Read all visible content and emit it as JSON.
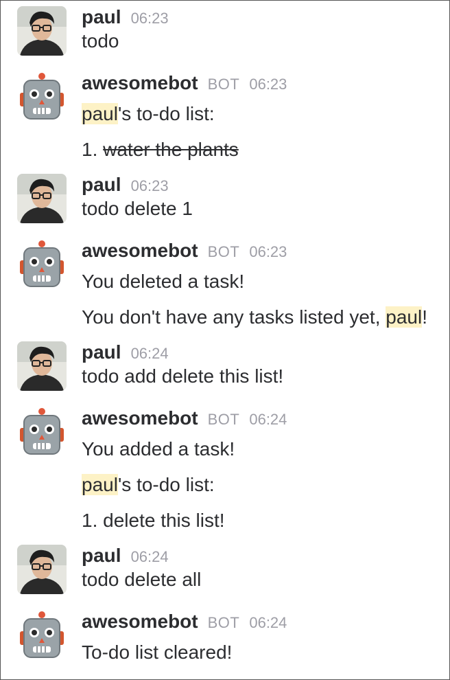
{
  "messages": [
    {
      "author": "paul",
      "time": "06:23",
      "lines": [
        {
          "text": "todo"
        }
      ]
    },
    {
      "author": "awesomebot",
      "badge": "BOT",
      "time": "06:23",
      "lines": [
        {
          "mention": "paul",
          "after": "'s to-do list:"
        },
        {
          "prefix": "1. ",
          "struck": "water the plants"
        }
      ]
    },
    {
      "author": "paul",
      "time": "06:23",
      "lines": [
        {
          "text": "todo delete 1"
        }
      ]
    },
    {
      "author": "awesomebot",
      "badge": "BOT",
      "time": "06:23",
      "lines": [
        {
          "text": "You deleted a task!"
        },
        {
          "before": "You don't have any tasks listed yet, ",
          "mention": "paul",
          "after": "!"
        }
      ]
    },
    {
      "author": "paul",
      "time": "06:24",
      "lines": [
        {
          "text": "todo add delete this list!"
        }
      ]
    },
    {
      "author": "awesomebot",
      "badge": "BOT",
      "time": "06:24",
      "lines": [
        {
          "text": "You added a task!"
        },
        {
          "mention": "paul",
          "after": "'s to-do list:"
        },
        {
          "text": "1. delete this list!"
        }
      ]
    },
    {
      "author": "paul",
      "time": "06:24",
      "lines": [
        {
          "text": "todo delete all"
        }
      ]
    },
    {
      "author": "awesomebot",
      "badge": "BOT",
      "time": "06:24",
      "lines": [
        {
          "text": "To-do list cleared!"
        }
      ]
    }
  ],
  "colors": {
    "mention_highlight": "#fdf2c6",
    "timestamp": "#9e9ea6",
    "text": "#2c2d30"
  },
  "icons": {
    "user_avatar": "paul-avatar-icon",
    "bot_avatar": "robot-face-icon"
  }
}
